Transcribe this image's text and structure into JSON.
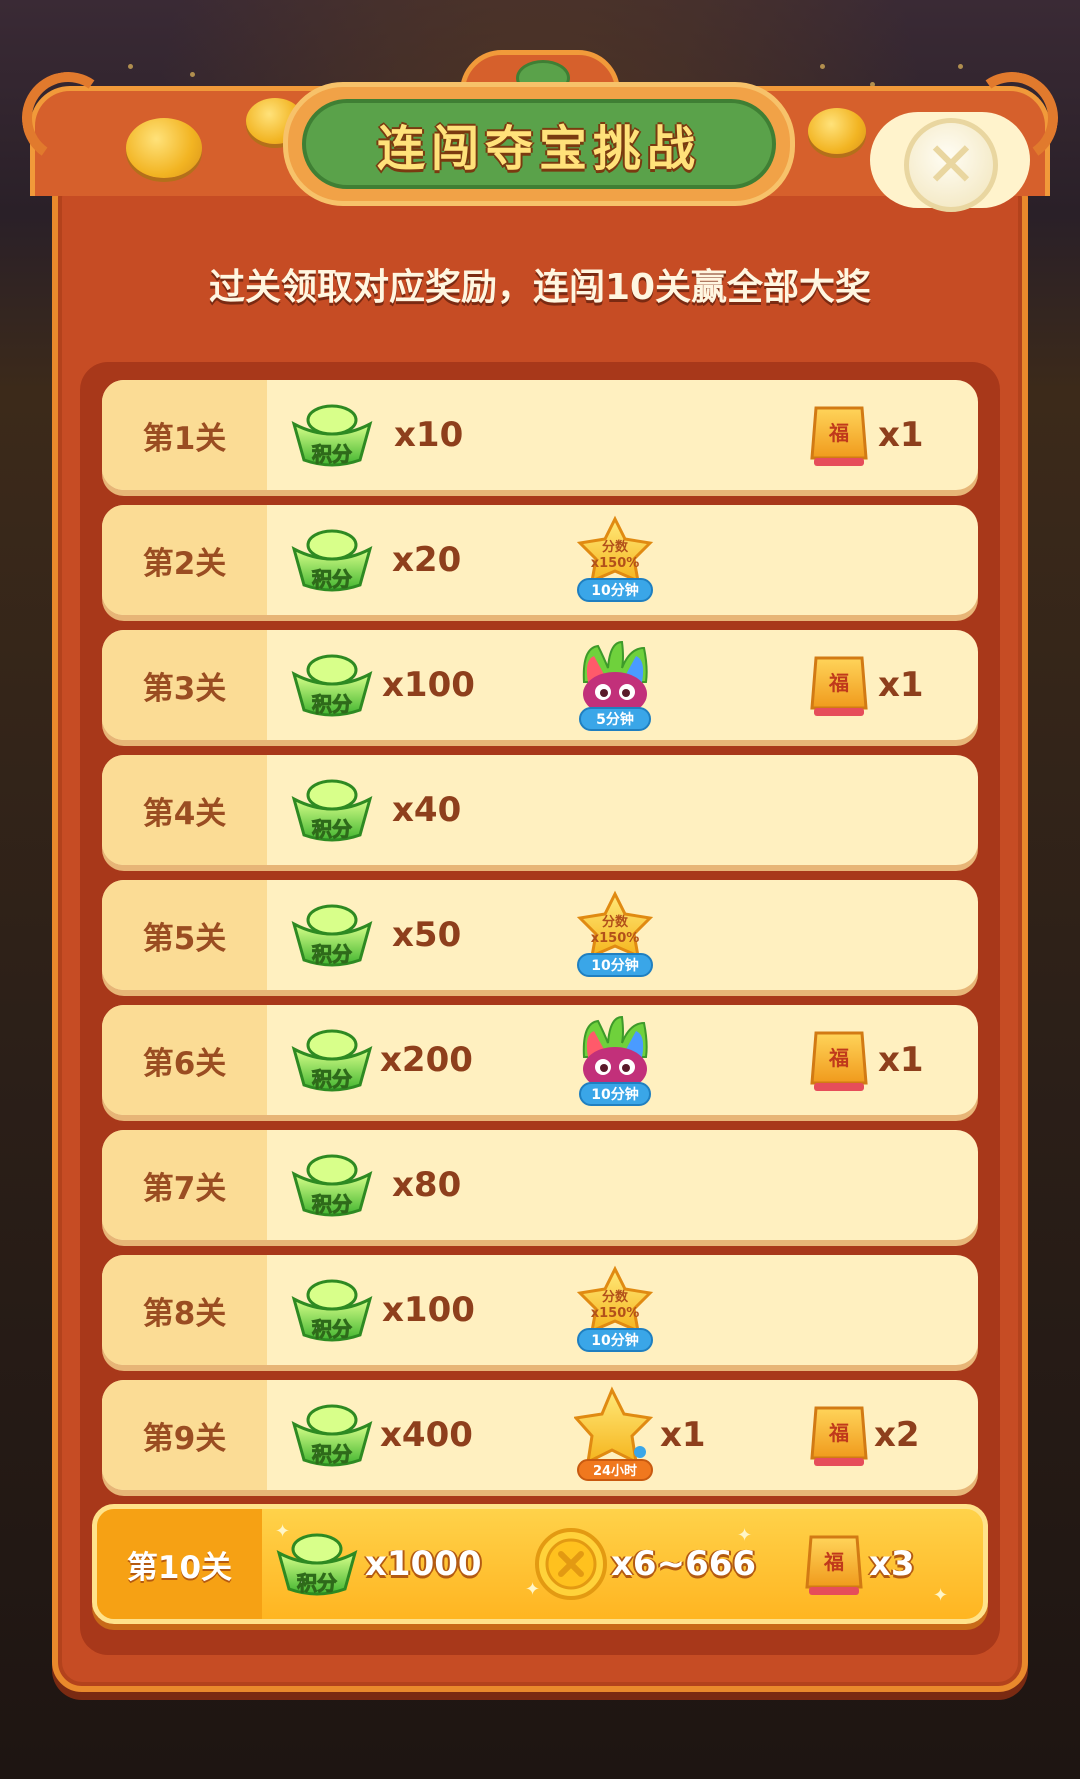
{
  "header": {
    "title": "连闯夺宝挑战",
    "subtitle": "过关领取对应奖励，连闯10关赢全部大奖",
    "close_icon": "close-icon"
  },
  "rewards": {
    "points_label": "积分",
    "fu_label": "福",
    "boost_label_top": "分数",
    "boost_label_mult": "x150%"
  },
  "levels": [
    {
      "label": "第1关",
      "points": "x10",
      "fu": "x1"
    },
    {
      "label": "第2关",
      "points": "x20",
      "boost_time": "10分钟"
    },
    {
      "label": "第3关",
      "points": "x100",
      "owl_time": "5分钟",
      "fu": "x1"
    },
    {
      "label": "第4关",
      "points": "x40"
    },
    {
      "label": "第5关",
      "points": "x50",
      "boost_time": "10分钟"
    },
    {
      "label": "第6关",
      "points": "x200",
      "owl_time": "10分钟",
      "fu": "x1"
    },
    {
      "label": "第7关",
      "points": "x80"
    },
    {
      "label": "第8关",
      "points": "x100",
      "boost_time": "10分钟"
    },
    {
      "label": "第9关",
      "points": "x400",
      "star_time": "24小时",
      "star_qty": "x1",
      "fu": "x2"
    },
    {
      "label": "第10关",
      "points": "x1000",
      "coin_qty": "x6~666",
      "fu": "x3"
    }
  ],
  "colors": {
    "panel": "#c64c24",
    "row_bg": "#fff0c0",
    "row_label_bg": "#fbdc95",
    "text_brown": "#8e3f1c",
    "final_row": "#ffc12e"
  }
}
